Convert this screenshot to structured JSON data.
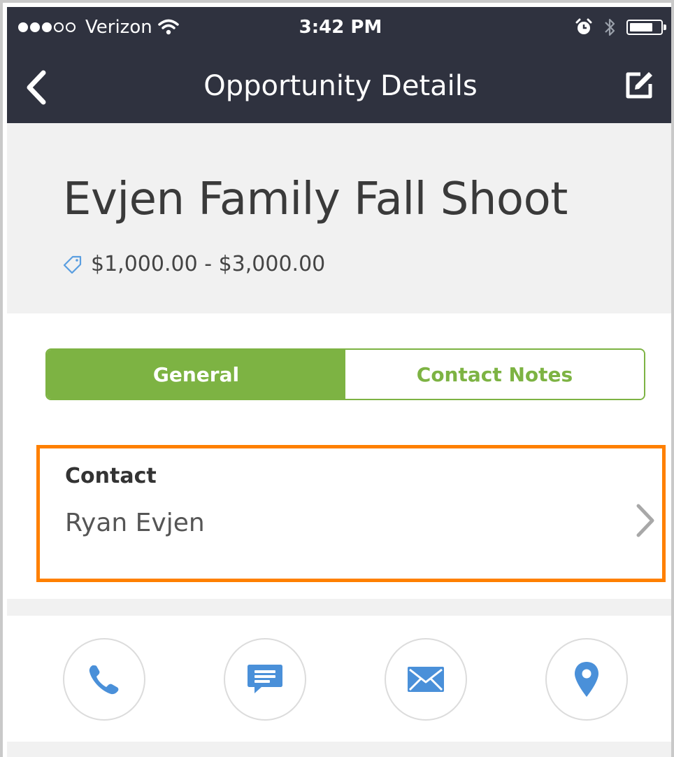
{
  "status_bar": {
    "carrier": "Verizon",
    "time": "3:42 PM",
    "signal_bars_filled": 3,
    "signal_bars_total": 5
  },
  "nav": {
    "title": "Opportunity Details",
    "back_icon": "chevron-left-icon",
    "edit_icon": "edit-icon"
  },
  "opportunity": {
    "title": "Evjen Family Fall Shoot",
    "price_range": "$1,000.00 - $3,000.00",
    "price_icon": "tag-icon"
  },
  "tabs": [
    {
      "label": "General",
      "active": true
    },
    {
      "label": "Contact Notes",
      "active": false
    }
  ],
  "contact": {
    "label": "Contact",
    "value": "Ryan Evjen"
  },
  "actions": [
    {
      "name": "call",
      "icon": "phone-icon"
    },
    {
      "name": "message",
      "icon": "chat-icon"
    },
    {
      "name": "email",
      "icon": "envelope-icon"
    },
    {
      "name": "location",
      "icon": "map-pin-icon"
    }
  ],
  "colors": {
    "nav_bg": "#2f323f",
    "accent_green": "#7db343",
    "highlight_orange": "#ff8000",
    "icon_blue": "#4a90d9"
  }
}
